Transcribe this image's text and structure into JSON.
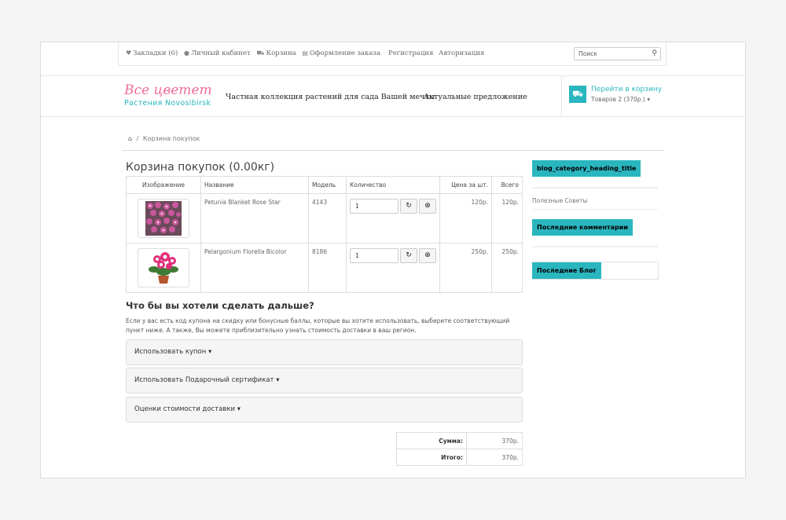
{
  "topbar": {
    "links": [
      {
        "icon": "heart-icon",
        "glyph": "♥",
        "label": "Закладки (0)"
      },
      {
        "icon": "user-icon",
        "glyph": "👤",
        "label": "Личный кабинет"
      },
      {
        "icon": "cart-icon",
        "glyph": "🛒",
        "label": "Корзина"
      },
      {
        "icon": "file-icon",
        "glyph": "🗎",
        "label": "Оформление заказа"
      }
    ],
    "register": "Регистрация",
    "login": "Авторизация",
    "search_placeholder": "Поиск"
  },
  "header": {
    "logo_main": "Все цветет",
    "logo_sub": "Растения Novosibirsk",
    "nav": [
      "Частная коллекция растений для сада Вашей мечты",
      "Актуальные предложение"
    ],
    "cart_link": "Перейти в корзину",
    "cart_count": "Товаров 2 (370р.)"
  },
  "breadcrumb": {
    "current": "Корзина покупок"
  },
  "main": {
    "title": "Корзина покупок  (0.00кг)",
    "columns": [
      "Изображение",
      "Название",
      "Модель",
      "Количество",
      "Цена за шт.",
      "Всего"
    ],
    "items": [
      {
        "name": "Petunia Blanket Rose Star",
        "model": "4143",
        "qty": "1",
        "price": "120р.",
        "total": "120р."
      },
      {
        "name": "Pelargonium Florella Bicolor",
        "model": "8186",
        "qty": "1",
        "price": "250р.",
        "total": "250р."
      }
    ],
    "next_title": "Что бы вы хотели сделать дальше?",
    "next_desc": "Если у вас есть код купона на скидку или бонусные баллы, которые вы хотите использовать, выберите соответствующий пункт ниже. А также, Вы можете приблизительно узнать стоимость доставки в ваш регион.",
    "accordions": [
      "Использовать купон",
      "Использовать Подарочный сертификат",
      "Оценки стоимости доставки"
    ],
    "totals": [
      {
        "label": "Сумма:",
        "value": "370р."
      },
      {
        "label": "Итого:",
        "value": "370р."
      }
    ]
  },
  "sidebar": {
    "heading1": "blog_category_heading_title",
    "link1": "Полезные Советы",
    "heading2": "Последние комментарии",
    "heading3": "Последние Блог"
  },
  "colors": {
    "accent": "#2ab6bf",
    "logo_pink": "#f06c9b"
  }
}
